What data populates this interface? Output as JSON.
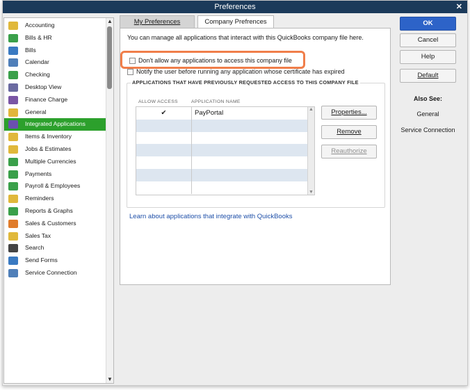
{
  "window": {
    "title": "Preferences",
    "close_glyph": "✕"
  },
  "sidebar": {
    "items": [
      {
        "label": "Accounting",
        "icon": "accounting-icon",
        "color": "#e0b83b"
      },
      {
        "label": "Bills & HR",
        "icon": "bills-hr-icon",
        "color": "#3aa04a"
      },
      {
        "label": "Bills",
        "icon": "bills-icon",
        "color": "#3a7ac2"
      },
      {
        "label": "Calendar",
        "icon": "calendar-icon",
        "color": "#4f7fb9"
      },
      {
        "label": "Checking",
        "icon": "checking-icon",
        "color": "#3aa04a"
      },
      {
        "label": "Desktop View",
        "icon": "desktop-view-icon",
        "color": "#6a6aa0"
      },
      {
        "label": "Finance Charge",
        "icon": "finance-charge-icon",
        "color": "#7a55a5"
      },
      {
        "label": "General",
        "icon": "general-icon",
        "color": "#e2b53b"
      },
      {
        "label": "Integrated Applications",
        "icon": "integrated-apps-icon",
        "color": "#6b4fb0",
        "selected": true
      },
      {
        "label": "Items & Inventory",
        "icon": "items-inventory-icon",
        "color": "#e0b83b"
      },
      {
        "label": "Jobs & Estimates",
        "icon": "jobs-estimates-icon",
        "color": "#e0b83b"
      },
      {
        "label": "Multiple Currencies",
        "icon": "multiple-currencies-icon",
        "color": "#3aa04a"
      },
      {
        "label": "Payments",
        "icon": "payments-icon",
        "color": "#3aa04a"
      },
      {
        "label": "Payroll & Employees",
        "icon": "payroll-employees-icon",
        "color": "#3aa04a"
      },
      {
        "label": "Reminders",
        "icon": "reminders-icon",
        "color": "#e0b83b"
      },
      {
        "label": "Reports & Graphs",
        "icon": "reports-graphs-icon",
        "color": "#3aa04a"
      },
      {
        "label": "Sales & Customers",
        "icon": "sales-customers-icon",
        "color": "#e07c2b"
      },
      {
        "label": "Sales Tax",
        "icon": "sales-tax-icon",
        "color": "#e0b83b"
      },
      {
        "label": "Search",
        "icon": "search-icon",
        "color": "#444444"
      },
      {
        "label": "Send Forms",
        "icon": "send-forms-icon",
        "color": "#3a7ac2"
      },
      {
        "label": "Service Connection",
        "icon": "service-connection-icon",
        "color": "#4f7fb9"
      }
    ]
  },
  "tabs": [
    {
      "label": "My Preferences"
    },
    {
      "label": "Company Prefrences"
    }
  ],
  "panel": {
    "intro": "You can manage all applications that interact with this QuickBooks company file here.",
    "chk_block": "Don't allow any applications to access this company file",
    "chk_notify": "Notify the user before running any application whose certificate has expired",
    "group_title": "APPLICATIONS THAT HAVE PREVIOUSLY REQUESTED ACCESS TO THIS COMPANY FILE",
    "col_allow": "ALLOW ACCESS",
    "col_name": "APPLICATION NAME",
    "rows": [
      {
        "allow": "✔",
        "name": "PayPortal"
      },
      {
        "allow": "",
        "name": ""
      },
      {
        "allow": "",
        "name": ""
      },
      {
        "allow": "",
        "name": ""
      },
      {
        "allow": "",
        "name": ""
      },
      {
        "allow": "",
        "name": ""
      },
      {
        "allow": "",
        "name": ""
      }
    ],
    "btn_properties": "Properties...",
    "btn_remove": "Remove",
    "btn_reauthorize": "Reauthorize",
    "link": "Learn about applications that integrate with QuickBooks"
  },
  "right": {
    "ok": "OK",
    "cancel": "Cancel",
    "help": "Help",
    "default": "Default",
    "also_see": "Also See:",
    "also_general": "General",
    "also_service": "Service Connection"
  },
  "colors": {
    "highlight": "#f07e4a",
    "selected": "#2ca02c",
    "ok": "#2d63c8",
    "titlebar": "#1b3a5a"
  }
}
